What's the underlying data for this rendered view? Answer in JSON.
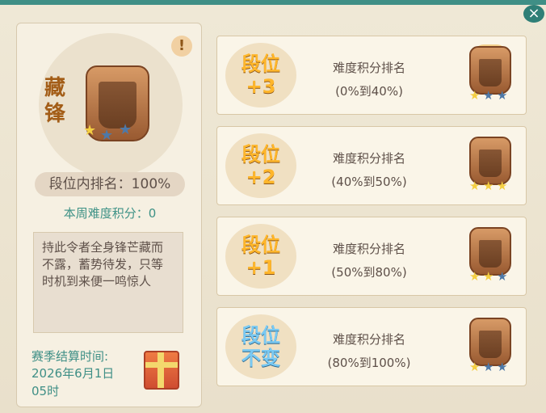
{
  "window": {
    "close_symbol": "×"
  },
  "left_panel": {
    "rank_title": "藏锋",
    "rank_in_tier": "段位内排名：100%",
    "weekly_score": "本周难度积分：0",
    "description": "持此令者全身锋芒藏而不露，蓄势待发，只等时机到来便一鸣惊人",
    "settlement_label": "赛季结算时间:",
    "settlement_date": "2026年6月1日",
    "settlement_hour": "05时",
    "warn_symbol": "!"
  },
  "cards": [
    {
      "badge_line1": "段位",
      "badge_line2": "+3",
      "title": "难度积分排名",
      "range": "(0%到40%)",
      "badge_style": "orange",
      "stars": [
        "gold",
        "blue",
        "blue"
      ],
      "gold_head": true
    },
    {
      "badge_line1": "段位",
      "badge_line2": "+2",
      "title": "难度积分排名",
      "range": "(40%到50%)",
      "badge_style": "orange",
      "stars": [
        "gold",
        "gold",
        "gold"
      ],
      "gold_head": false
    },
    {
      "badge_line1": "段位",
      "badge_line2": "+1",
      "title": "难度积分排名",
      "range": "(50%到80%)",
      "badge_style": "orange",
      "stars": [
        "gold",
        "gold",
        "blue"
      ],
      "gold_head": false
    },
    {
      "badge_line1": "段位",
      "badge_line2": "不变",
      "title": "难度积分排名",
      "range": "(80%到100%)",
      "badge_style": "blue",
      "stars": [
        "gold",
        "blue",
        "blue"
      ],
      "gold_head": false
    }
  ],
  "colors": {
    "accent": "#3f8f86",
    "orange_badge": "#ffb62a",
    "blue_badge": "#79c9f3",
    "gold_star": "#f4cf42",
    "blue_star": "#4e79a8"
  }
}
